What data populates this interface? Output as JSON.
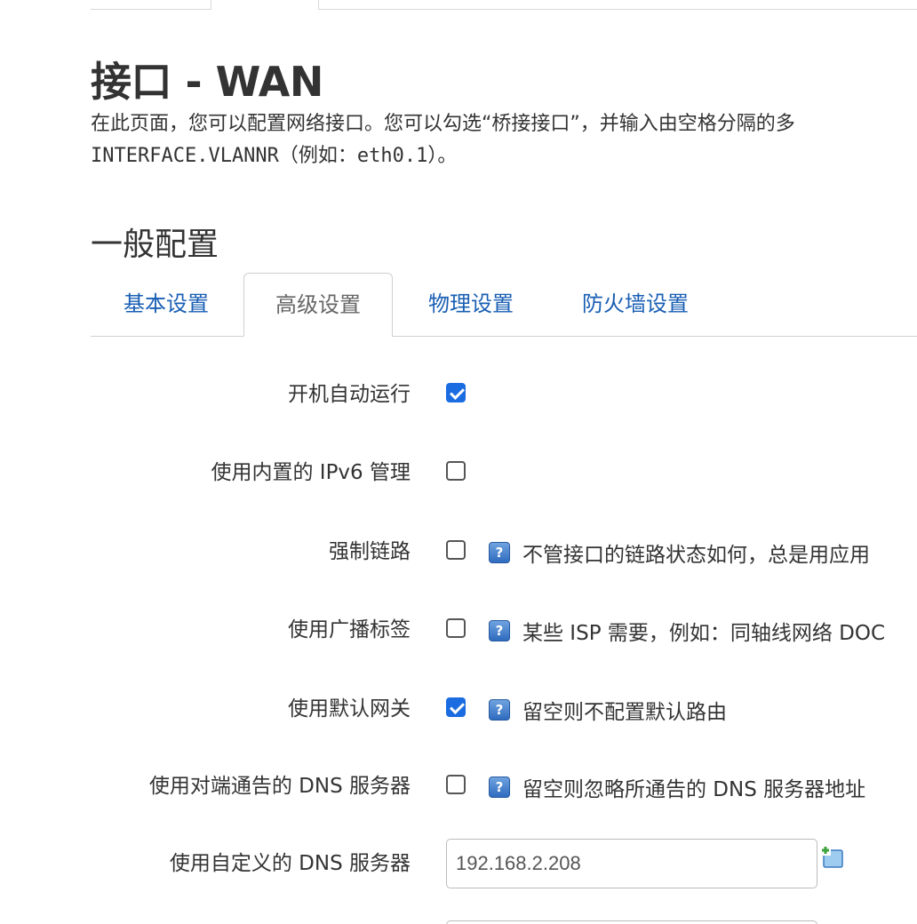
{
  "page": {
    "title": "接口 - WAN",
    "description_line1": "在此页面，您可以配置网络接口。您可以勾选“桥接接口”，并输入由空格分隔的多",
    "description_line2": "INTERFACE.VLANNR（例如：eth0.1）。"
  },
  "section": {
    "title": "一般配置"
  },
  "tabs": [
    {
      "label": "基本设置",
      "active": false
    },
    {
      "label": "高级设置",
      "active": true
    },
    {
      "label": "物理设置",
      "active": false
    },
    {
      "label": "防火墙设置",
      "active": false
    }
  ],
  "options": [
    {
      "label": "开机自动运行",
      "checked": true,
      "help": ""
    },
    {
      "label": "使用内置的 IPv6 管理",
      "checked": false,
      "help": ""
    },
    {
      "label": "强制链路",
      "checked": false,
      "help": "不管接口的链路状态如何，总是用应用"
    },
    {
      "label": "使用广播标签",
      "checked": false,
      "help": "某些 ISP 需要，例如：同轴线网络 DOC"
    },
    {
      "label": "使用默认网关",
      "checked": true,
      "help": "留空则不配置默认路由"
    },
    {
      "label": "使用对端通告的 DNS 服务器",
      "checked": false,
      "help": "留空则忽略所通告的 DNS 服务器地址"
    }
  ],
  "custom_dns": {
    "label": "使用自定义的 DNS 服务器",
    "value": "192.168.2.208"
  },
  "colors": {
    "accent": "#1a6ce0",
    "link": "#1a5fb4",
    "help_icon": "#2f6bbf"
  },
  "icons": {
    "help": "help-question-icon",
    "add": "add-entry-icon"
  }
}
